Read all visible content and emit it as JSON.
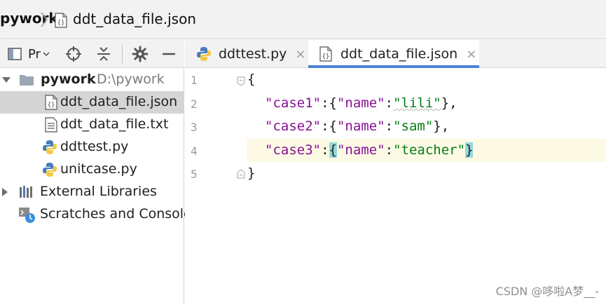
{
  "breadcrumb": {
    "project": "pywork",
    "file": "ddt_data_file.json"
  },
  "panel": {
    "title": "Pr",
    "tree": {
      "root": {
        "label": "pywork",
        "path": "D:\\pywork"
      },
      "files": [
        {
          "label": "ddt_data_file.json",
          "icon": "json-file-icon",
          "selected": true
        },
        {
          "label": "ddt_data_file.txt",
          "icon": "text-file-icon",
          "selected": false
        },
        {
          "label": "ddttest.py",
          "icon": "python-file-icon",
          "selected": false
        },
        {
          "label": "unitcase.py",
          "icon": "python-file-icon",
          "selected": false
        }
      ],
      "external": "External Libraries",
      "scratches": "Scratches and Console"
    }
  },
  "tabs": [
    {
      "label": "ddttest.py",
      "icon": "python-file-icon",
      "active": false,
      "close": "×"
    },
    {
      "label": "ddt_data_file.json",
      "icon": "json-file-icon",
      "active": true,
      "close": "×"
    }
  ],
  "editor": {
    "line_numbers": [
      "1",
      "2",
      "3",
      "4",
      "5"
    ],
    "current_line": 4,
    "lines": [
      {
        "open": "{"
      },
      {
        "key": "\"case1\"",
        "colon": ":",
        "lb": "{",
        "inner_key": "\"name\"",
        "inner_colon": ":",
        "value": "\"lili\"",
        "rb": "}",
        "comma": ","
      },
      {
        "key": "\"case2\"",
        "colon": ":",
        "lb": "{",
        "inner_key": "\"name\"",
        "inner_colon": ":",
        "value": "\"sam\"",
        "rb": "}",
        "comma": ","
      },
      {
        "key": "\"case3\"",
        "colon": ":",
        "lb": "{",
        "inner_key": "\"name\"",
        "inner_colon": ":",
        "value": "\"teacher\"",
        "rb": "}",
        "comma": ""
      },
      {
        "close": "}"
      }
    ]
  },
  "watermark": "CSDN @哆啦A梦__-",
  "colors": {
    "keyword_purple": "#871094",
    "string_green": "#067d17",
    "brace_highlight": "#93d9d9",
    "current_line": "#fcfae5",
    "tab_underline": "#4a83d0",
    "selection": "#d5d5d5"
  }
}
